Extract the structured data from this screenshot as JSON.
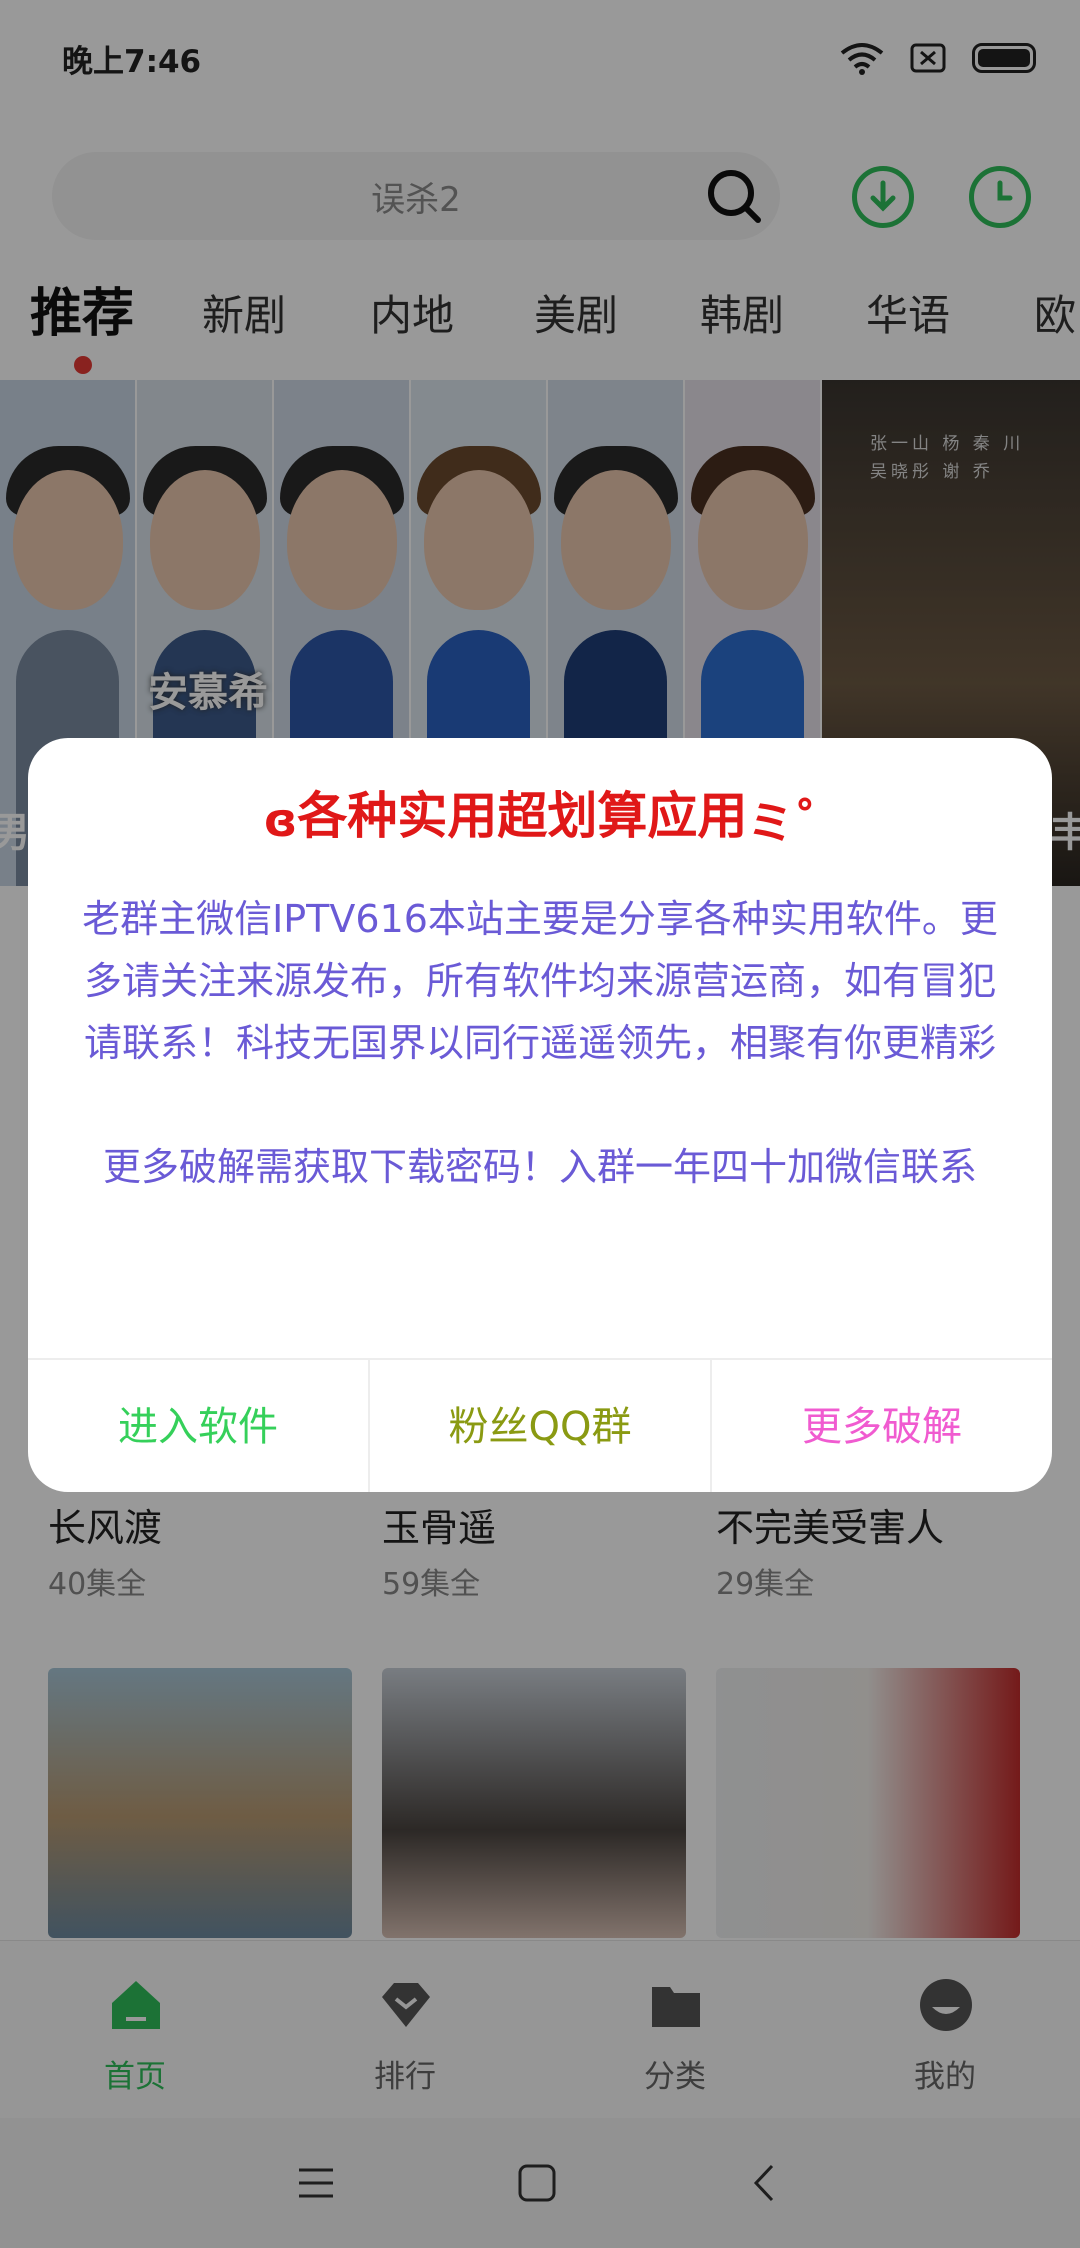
{
  "status_bar": {
    "time": "晚上7:46",
    "icons": [
      "wifi-icon",
      "sim-off-icon",
      "battery-icon"
    ]
  },
  "search": {
    "placeholder": "误杀2"
  },
  "header_actions": [
    "download-icon",
    "history-icon"
  ],
  "tabs": [
    "推荐",
    "新剧",
    "内地",
    "美剧",
    "韩剧",
    "华语",
    "欧"
  ],
  "banner": {
    "overlay_text": "安慕希",
    "right_poster_credits": "张一山 杨 秦 川\n吴晓彤 谢 乔",
    "right_edge_text_left": "男!",
    "right_edge_text_right": "丰"
  },
  "grid": [
    {
      "title": "长风渡",
      "sub": "40集全"
    },
    {
      "title": "玉骨遥",
      "sub": "59集全"
    },
    {
      "title": "不完美受害人",
      "sub": "29集全"
    }
  ],
  "bottom_nav": [
    {
      "label": "首页",
      "icon": "home-icon"
    },
    {
      "label": "排行",
      "icon": "ranking-icon"
    },
    {
      "label": "分类",
      "icon": "folder-icon"
    },
    {
      "label": "我的",
      "icon": "profile-icon"
    }
  ],
  "dialog": {
    "title": "各种实用超划算应用",
    "message": "老群主微信IPTV616本站主要是分享各种实用软件。更多请关注来源发布，所有软件均来源营运商，如有冒犯请联系！科技无国界以同行遥遥领先，相聚有你更精彩\n\n更多破解需获取下载密码！入群一年四十加微信联系",
    "buttons": [
      {
        "label": "进入软件",
        "color": "#35d05a"
      },
      {
        "label": "粉丝QQ群",
        "color": "#8a9a12"
      },
      {
        "label": "更多破解",
        "color": "#f05bd0"
      }
    ]
  },
  "colors": {
    "accent": "#2fbf5a",
    "tab_indicator": "#e53935",
    "dialog_title": "#e01818",
    "dialog_text": "#6a5ad6"
  }
}
